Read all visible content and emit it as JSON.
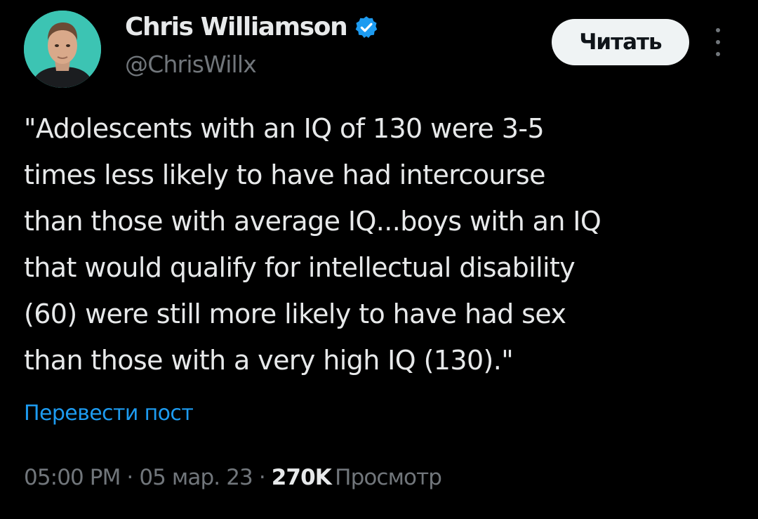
{
  "author": {
    "display_name": "Chris Williamson",
    "handle": "@ChrisWillx",
    "verified": true,
    "avatar_icon": "person-photo-icon",
    "avatar_bg": "#3cc4b3",
    "verified_color": "#1d9bf0"
  },
  "actions": {
    "follow_label": "Читать",
    "more_icon": "more-vertical-icon"
  },
  "tweet": {
    "lines": [
      "\"Adolescents with an IQ of 130 were 3-5",
      "times less likely to have had intercourse",
      "than those with average IQ...boys with an IQ",
      "that would qualify for intellectual disability",
      "(60) were still more likely to have had sex",
      "than those with a very high IQ (130).\""
    ],
    "translate_label": "Перевести пост"
  },
  "meta": {
    "time": "05:00 PM",
    "date": "05 мар. 23",
    "separator": "·",
    "views_count": "270K",
    "views_label": "Просмотр"
  },
  "colors": {
    "background": "#000000",
    "text_primary": "#e7e9ea",
    "text_secondary": "#71767b",
    "link": "#1d9bf0",
    "button_bg": "#eff3f4"
  }
}
